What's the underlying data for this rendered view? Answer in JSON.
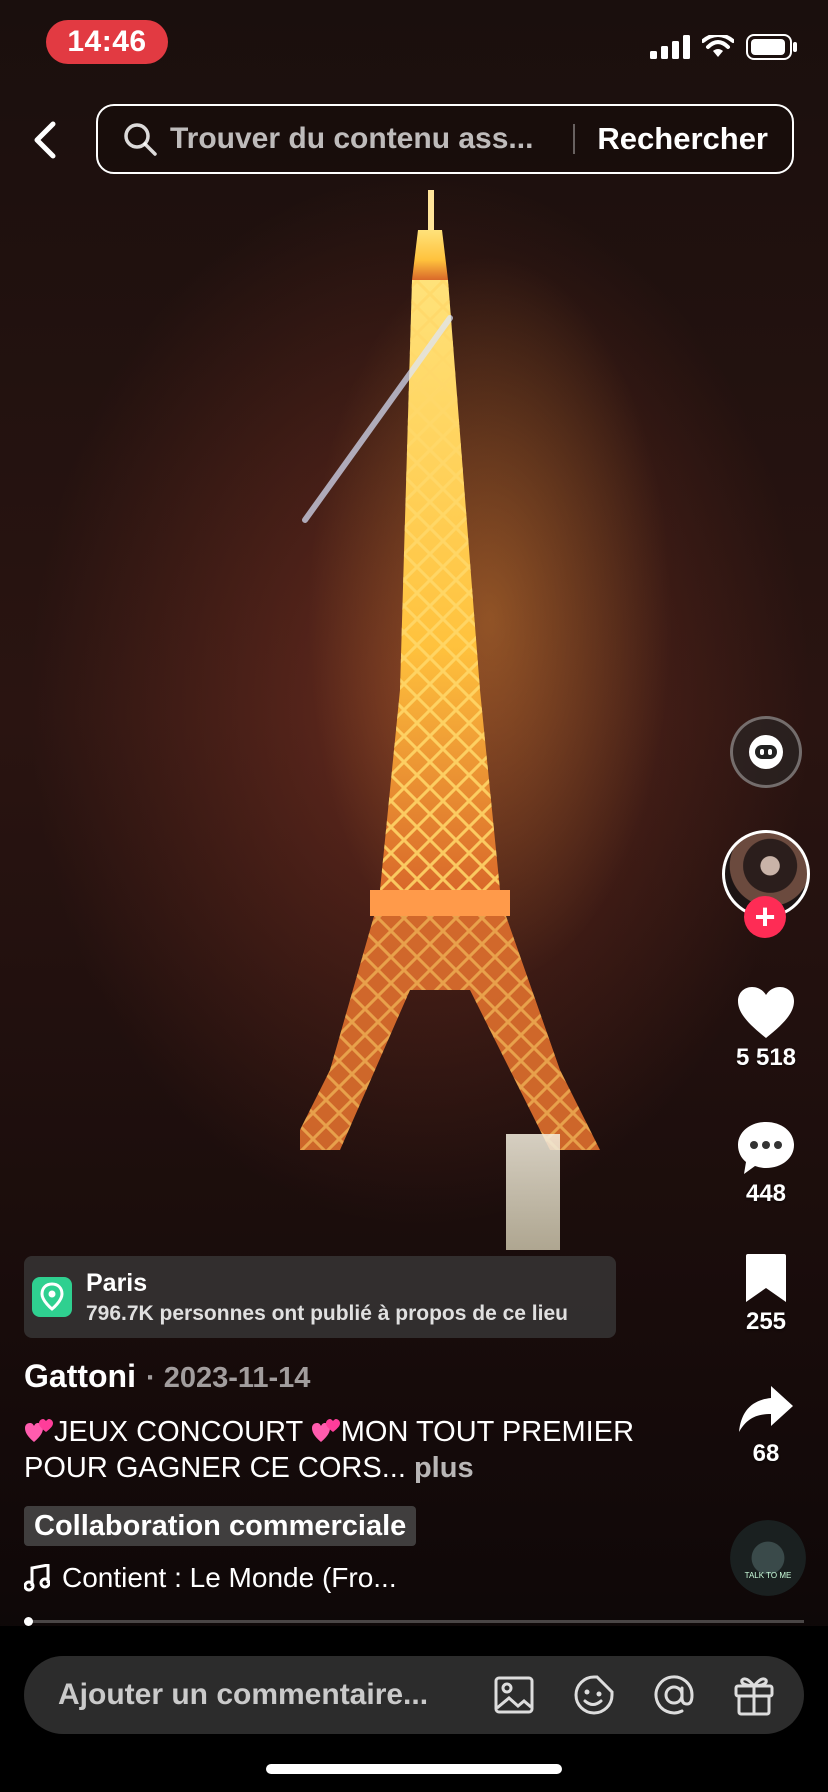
{
  "status_bar": {
    "time": "14:46"
  },
  "search": {
    "placeholder": "Trouver du contenu ass...",
    "button_label": "Rechercher"
  },
  "right_rail": {
    "likes": "5 518",
    "comments": "448",
    "saves": "255",
    "shares": "68",
    "music_disc_text": "TALK TO ME"
  },
  "location": {
    "name": "Paris",
    "subtitle": "796.7K personnes ont publié à propos de ce lieu"
  },
  "post": {
    "author": "Gattoni",
    "date": "· 2023-11-14",
    "caption_part1": "JEUX CONCOURT ",
    "caption_part2": "MON TOUT PREMIER POUR GAGNER CE CORS...",
    "more_label": "plus",
    "collab_label": "Collaboration commerciale",
    "music": "Contient : Le Monde (Fro..."
  },
  "comment_bar": {
    "placeholder": "Ajouter un commentaire..."
  },
  "colors": {
    "accent": "#fe2c55",
    "status_pill": "#e23a42",
    "location_icon": "#2fd090"
  },
  "icons": [
    "back-icon",
    "search-icon",
    "robot-icon",
    "heart-icon",
    "comment-icon",
    "bookmark-icon",
    "share-icon",
    "image-icon",
    "emoji-icon",
    "mention-icon",
    "gift-icon",
    "music-note-icon",
    "location-pin-icon"
  ]
}
